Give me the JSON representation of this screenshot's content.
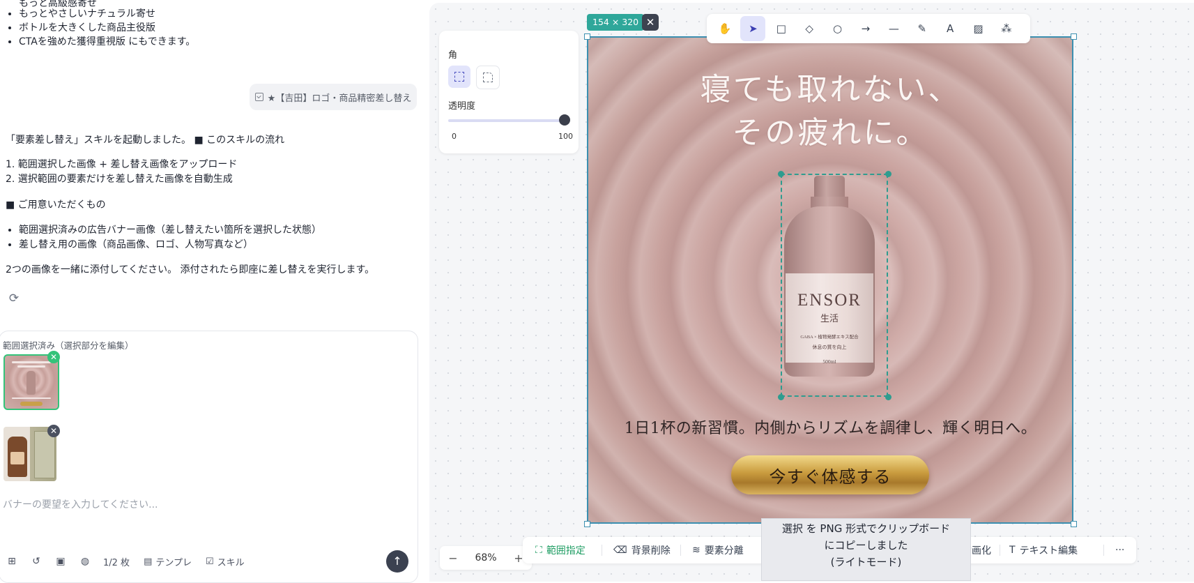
{
  "chat": {
    "prev_bullets": [
      "もっと高級感寄せ",
      "もっとやさしいナチュラル寄せ",
      "ボトルを大きくした商品主役版",
      "CTAを強めた獲得重視版 にもできます。"
    ],
    "user_message": "★【吉田】ロゴ・商品精密差し替え",
    "assistant_intro": "「要素差し替え」スキルを起動しました。 ■ このスキルの流れ",
    "steps": [
      "1. 範囲選択した画像 + 差し替え画像をアップロード",
      "2. 選択範囲の要素だけを差し替えた画像を自動生成"
    ],
    "prepare_heading": "■ ご用意いただくもの",
    "prepare_items": [
      "範囲選択済みの広告バナー画像（差し替えたい箇所を選択した状態）",
      "差し替え用の画像（商品画像、ロゴ、人物写真など）"
    ],
    "attach_instruction": "2つの画像を一緒に添付してください。 添付されたら即座に差し替えを実行します。"
  },
  "composer": {
    "selection_label": "範囲選択済み（選択部分を編集）",
    "placeholder": "バナーの要望を入力してください...",
    "page_count": "1/2 枚",
    "template_label": "テンプレ",
    "skill_label": "スキル"
  },
  "canvas": {
    "selection_size": "154 × 320",
    "props": {
      "corner_label": "角",
      "opacity_label": "透明度",
      "opacity_min": "0",
      "opacity_max": "100",
      "opacity_value": 100
    },
    "zoom": "68%",
    "tools": [
      "hand-icon",
      "pointer-icon",
      "rectangle-icon",
      "diamond-icon",
      "circle-icon",
      "arrow-icon",
      "line-icon",
      "pencil-icon",
      "text-icon",
      "image-icon",
      "shapes-icon"
    ]
  },
  "banner": {
    "headline_1": "寝ても取れない、",
    "headline_2": "その疲れに。",
    "brand": "ENSOR",
    "brand_sub": "生活",
    "label_line_1": "GABA × 植物発酵エキス配合",
    "label_line_2": "休息の質を向上",
    "volume": "500ml",
    "subcopy": "1日1杯の新習慣。内側からリズムを調律し、輝く明日へ。",
    "cta": "今すぐ体感する"
  },
  "bottom_bar": {
    "range": "範囲指定",
    "remove_bg": "背景削除",
    "split": "要素分離",
    "animate": "動画化",
    "text_edit": "テキスト編集",
    "more": "···"
  },
  "toast": {
    "line_1": "選択 を PNG 形式でクリップボード",
    "line_2": "にコピーしました",
    "line_3": "(ライトモード)"
  },
  "colors": {
    "accent_green": "#1f9d63",
    "selection_teal": "#2e9c8f",
    "frame_blue": "#3b8fb0",
    "tool_active": "#e2e4fb"
  }
}
